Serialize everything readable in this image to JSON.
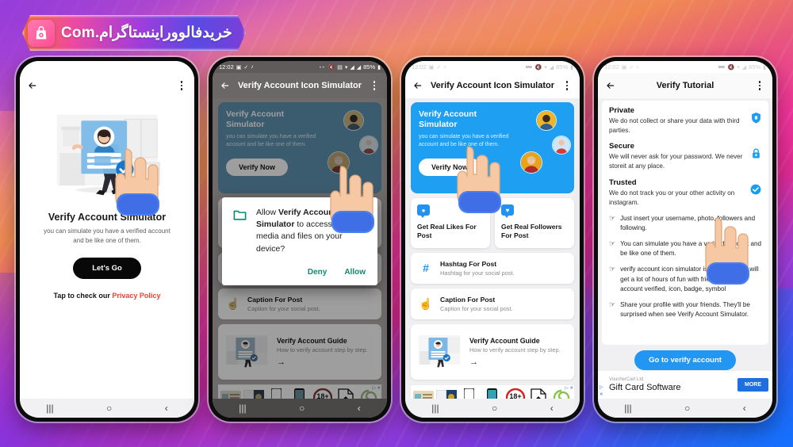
{
  "brand": {
    "logo_text": "خریدفالووراینستاگرام.Com",
    "logo_icon": "shopping-bag-camera-icon",
    "accent_pink": "#ff4f96",
    "accent_blue": "#2196f3"
  },
  "status_bar": {
    "time": "12:02",
    "battery": "85%",
    "icons": [
      "image-icon",
      "check-icon",
      "music-note-icon",
      "glasses-icon",
      "mute-icon",
      "vibrate-icon",
      "wifi-icon",
      "signal-icon",
      "signal-icon",
      "battery-icon"
    ]
  },
  "phone1": {
    "appbar": {
      "back_icon": "back-arrow-icon",
      "menu_icon": "more-vertical-icon",
      "title": ""
    },
    "illustration": "verify-account-illustration",
    "title": "Verify Account Simulator",
    "subtitle": "you can simulate you have a verified account and be like one of them.",
    "cta": "Let's Go",
    "privacy_prefix": "Tap to check our ",
    "privacy_link": "Privacy Policy",
    "nav": [
      "recents-icon",
      "home-icon",
      "back-icon"
    ]
  },
  "phone2": {
    "appbar": {
      "title": "Verify Account Icon Simulator",
      "back_icon": "back-arrow-icon",
      "menu_icon": "more-vertical-icon"
    },
    "dialog": {
      "icon": "folder-icon",
      "text_before": "Allow ",
      "text_bold": "Verify Account Simulator",
      "text_after": " to access photos, media and files on your device?",
      "deny": "Deny",
      "allow": "Allow"
    }
  },
  "phone3": {
    "appbar": {
      "title": "Verify Account Icon Simulator",
      "back_icon": "back-arrow-icon",
      "menu_icon": "more-vertical-icon"
    },
    "banner": {
      "title": "Verify Account Simulator",
      "text": "you can simulate you have a verified account and be like one of them.",
      "button": "Verify Now",
      "bg": "#1e9ff2"
    },
    "tiles": [
      {
        "icon": "person-badge-icon",
        "label": "Get Real Likes For Post"
      },
      {
        "icon": "heart-badge-icon",
        "label": "Get Real Followers For Post"
      }
    ],
    "rows": [
      {
        "icon": "hashtag-icon",
        "title": "Hashtag For Post",
        "subtitle": "Hashtag for your social post."
      },
      {
        "icon": "pointing-hand-icon",
        "title": "Caption For Post",
        "subtitle": "Caption for your social post."
      }
    ],
    "guide": {
      "icon": "verify-account-illustration",
      "title": "Verify Account Guide",
      "subtitle": "How to verify account step by step.",
      "arrow": "arrow-right-icon"
    },
    "ad": {
      "tag": "ad-choices-icon",
      "close": "close-icon",
      "cells": [
        "id-card-icon",
        "passport-icon",
        "phone-white-icon",
        "phone-teal-icon",
        "18plus-icon",
        "upload-file-icon",
        "spiral-icon"
      ]
    }
  },
  "phone4": {
    "appbar": {
      "title": "Verify Tutorial",
      "back_icon": "back-arrow-icon",
      "menu_icon": "more-vertical-icon"
    },
    "blocks": [
      {
        "heading": "Private",
        "text": "We do not collect or share your data with third parties.",
        "badge": "shield-icon"
      },
      {
        "heading": "Secure",
        "text": "We will never ask for your password. We never storeit at any place.",
        "badge": "lock-icon"
      },
      {
        "heading": "Trusted",
        "text": "We do not track you or your other activity on instagram.",
        "badge": "check-circle-icon"
      }
    ],
    "bullets": [
      "Just insert your username, photo, followers and following.",
      "You can simulate you have a verified account and be like one of them.",
      "verify account icon simulator is safe, and you will get a lot of hours of fun with friends. Official account verified, icon, badge, symbol",
      "Share your profile with your friends. They'll be surprised when see Verify Account Simulator."
    ],
    "cta": "Go to verify account",
    "ad": {
      "brand": "VoucherCart Ltd",
      "title": "Gift Card Software",
      "more": "MORE",
      "d_icon": "ad-triangle-icon",
      "x_icon": "close-icon"
    }
  }
}
